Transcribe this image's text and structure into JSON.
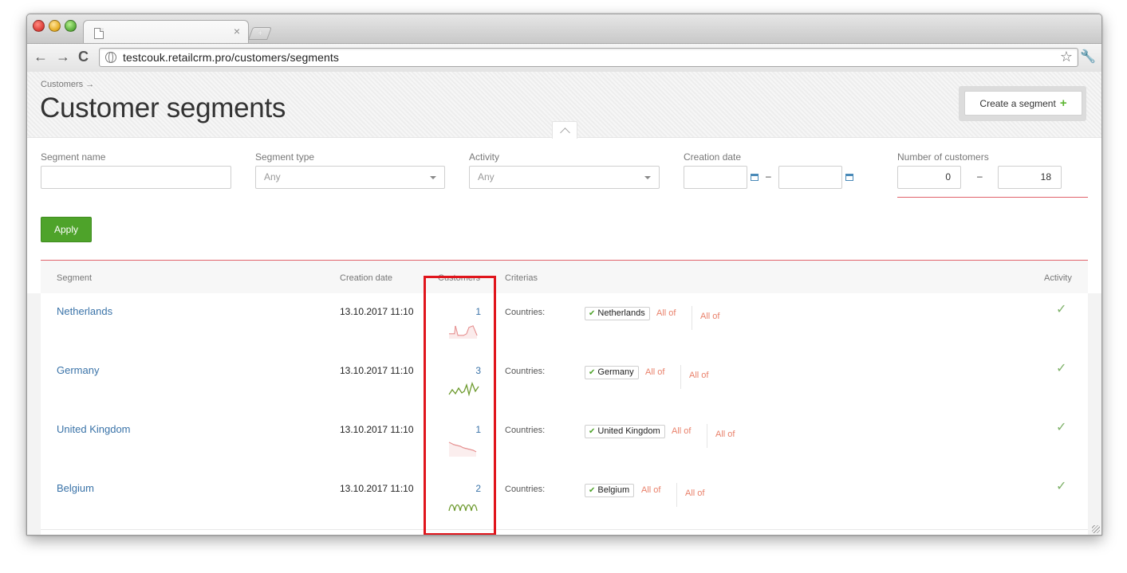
{
  "browser": {
    "url": "testcouk.retailcrm.pro/customers/segments",
    "tab_close": "×",
    "new_tab": "+"
  },
  "header": {
    "breadcrumb": "Customers →",
    "title": "Customer segments",
    "create_label": "Create a segment"
  },
  "filters": {
    "segment_name_label": "Segment name",
    "segment_type_label": "Segment type",
    "segment_type_value": "Any",
    "activity_label": "Activity",
    "activity_value": "Any",
    "creation_date_label": "Creation date",
    "number_label": "Number of customers",
    "number_from": "0",
    "number_to": "18",
    "dash": "–",
    "apply_label": "Apply"
  },
  "table": {
    "columns": {
      "segment": "Segment",
      "creation_date": "Creation date",
      "customers": "Customers",
      "criterias": "Criterias",
      "activity": "Activity"
    },
    "rows": [
      {
        "name": "Netherlands",
        "date": "13.10.2017 11:10",
        "customers": "1",
        "criteria_label": "Countries:",
        "country": "Netherlands",
        "all_of_1": "All of",
        "all_of_2": "All of"
      },
      {
        "name": "Germany",
        "date": "13.10.2017 11:10",
        "customers": "3",
        "criteria_label": "Countries:",
        "country": "Germany",
        "all_of_1": "All of",
        "all_of_2": "All of"
      },
      {
        "name": "United Kingdom",
        "date": "13.10.2017 11:10",
        "customers": "1",
        "criteria_label": "Countries:",
        "country": "United Kingdom",
        "all_of_1": "All of",
        "all_of_2": "All of"
      },
      {
        "name": "Belgium",
        "date": "13.10.2017 11:10",
        "customers": "2",
        "criteria_label": "Countries:",
        "country": "Belgium",
        "all_of_1": "All of",
        "all_of_2": "All of"
      }
    ]
  },
  "colors": {
    "accent_green": "#4ea32a",
    "link_blue": "#3a73a8",
    "alert_red": "#e0626a",
    "highlight_red": "#e0151c",
    "all_of_orange": "#e9806a"
  }
}
